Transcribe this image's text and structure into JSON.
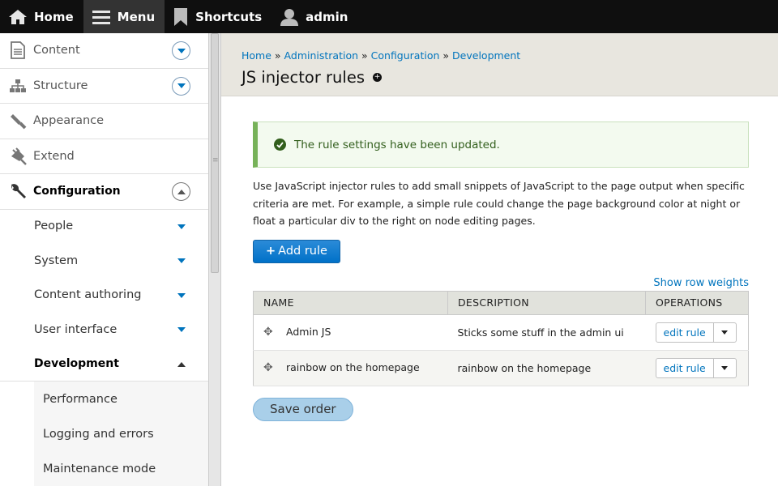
{
  "toolbar": {
    "home_label": "Home",
    "menu_label": "Menu",
    "shortcuts_label": "Shortcuts",
    "user_label": "admin"
  },
  "sidebar": {
    "top_items": [
      {
        "label": "Content"
      },
      {
        "label": "Structure"
      },
      {
        "label": "Appearance"
      },
      {
        "label": "Extend"
      },
      {
        "label": "Configuration"
      }
    ],
    "config_children": [
      {
        "label": "People"
      },
      {
        "label": "System"
      },
      {
        "label": "Content authoring"
      },
      {
        "label": "User interface"
      },
      {
        "label": "Development"
      }
    ],
    "development_children": [
      {
        "label": "Performance"
      },
      {
        "label": "Logging and errors"
      },
      {
        "label": "Maintenance mode"
      }
    ]
  },
  "breadcrumb": {
    "items": [
      "Home",
      "Administration",
      "Configuration",
      "Development"
    ],
    "separator": "»"
  },
  "page_title": "JS injector rules",
  "status_message": "The rule settings have been updated.",
  "description": "Use JavaScript injector rules to add small snippets of JavaScript to the page output when specific criteria are met. For example, a simple rule could change the page background color at night or float a particular div to the right on node editing pages.",
  "add_rule_label": "Add rule",
  "show_row_weights_label": "Show row weights",
  "table": {
    "headers": [
      "NAME",
      "DESCRIPTION",
      "OPERATIONS"
    ],
    "rows": [
      {
        "name": "Admin JS",
        "description": "Sticks some stuff in the admin ui",
        "operation": "edit rule"
      },
      {
        "name": "rainbow on the homepage",
        "description": "rainbow on the homepage",
        "operation": "edit rule"
      }
    ]
  },
  "save_order_label": "Save order",
  "colors": {
    "link": "#0074bd",
    "toolbar_bg": "#0f0f0f",
    "header_bg": "#e8e6df",
    "status_border": "#77b259",
    "primary_button": "#0071c8"
  }
}
